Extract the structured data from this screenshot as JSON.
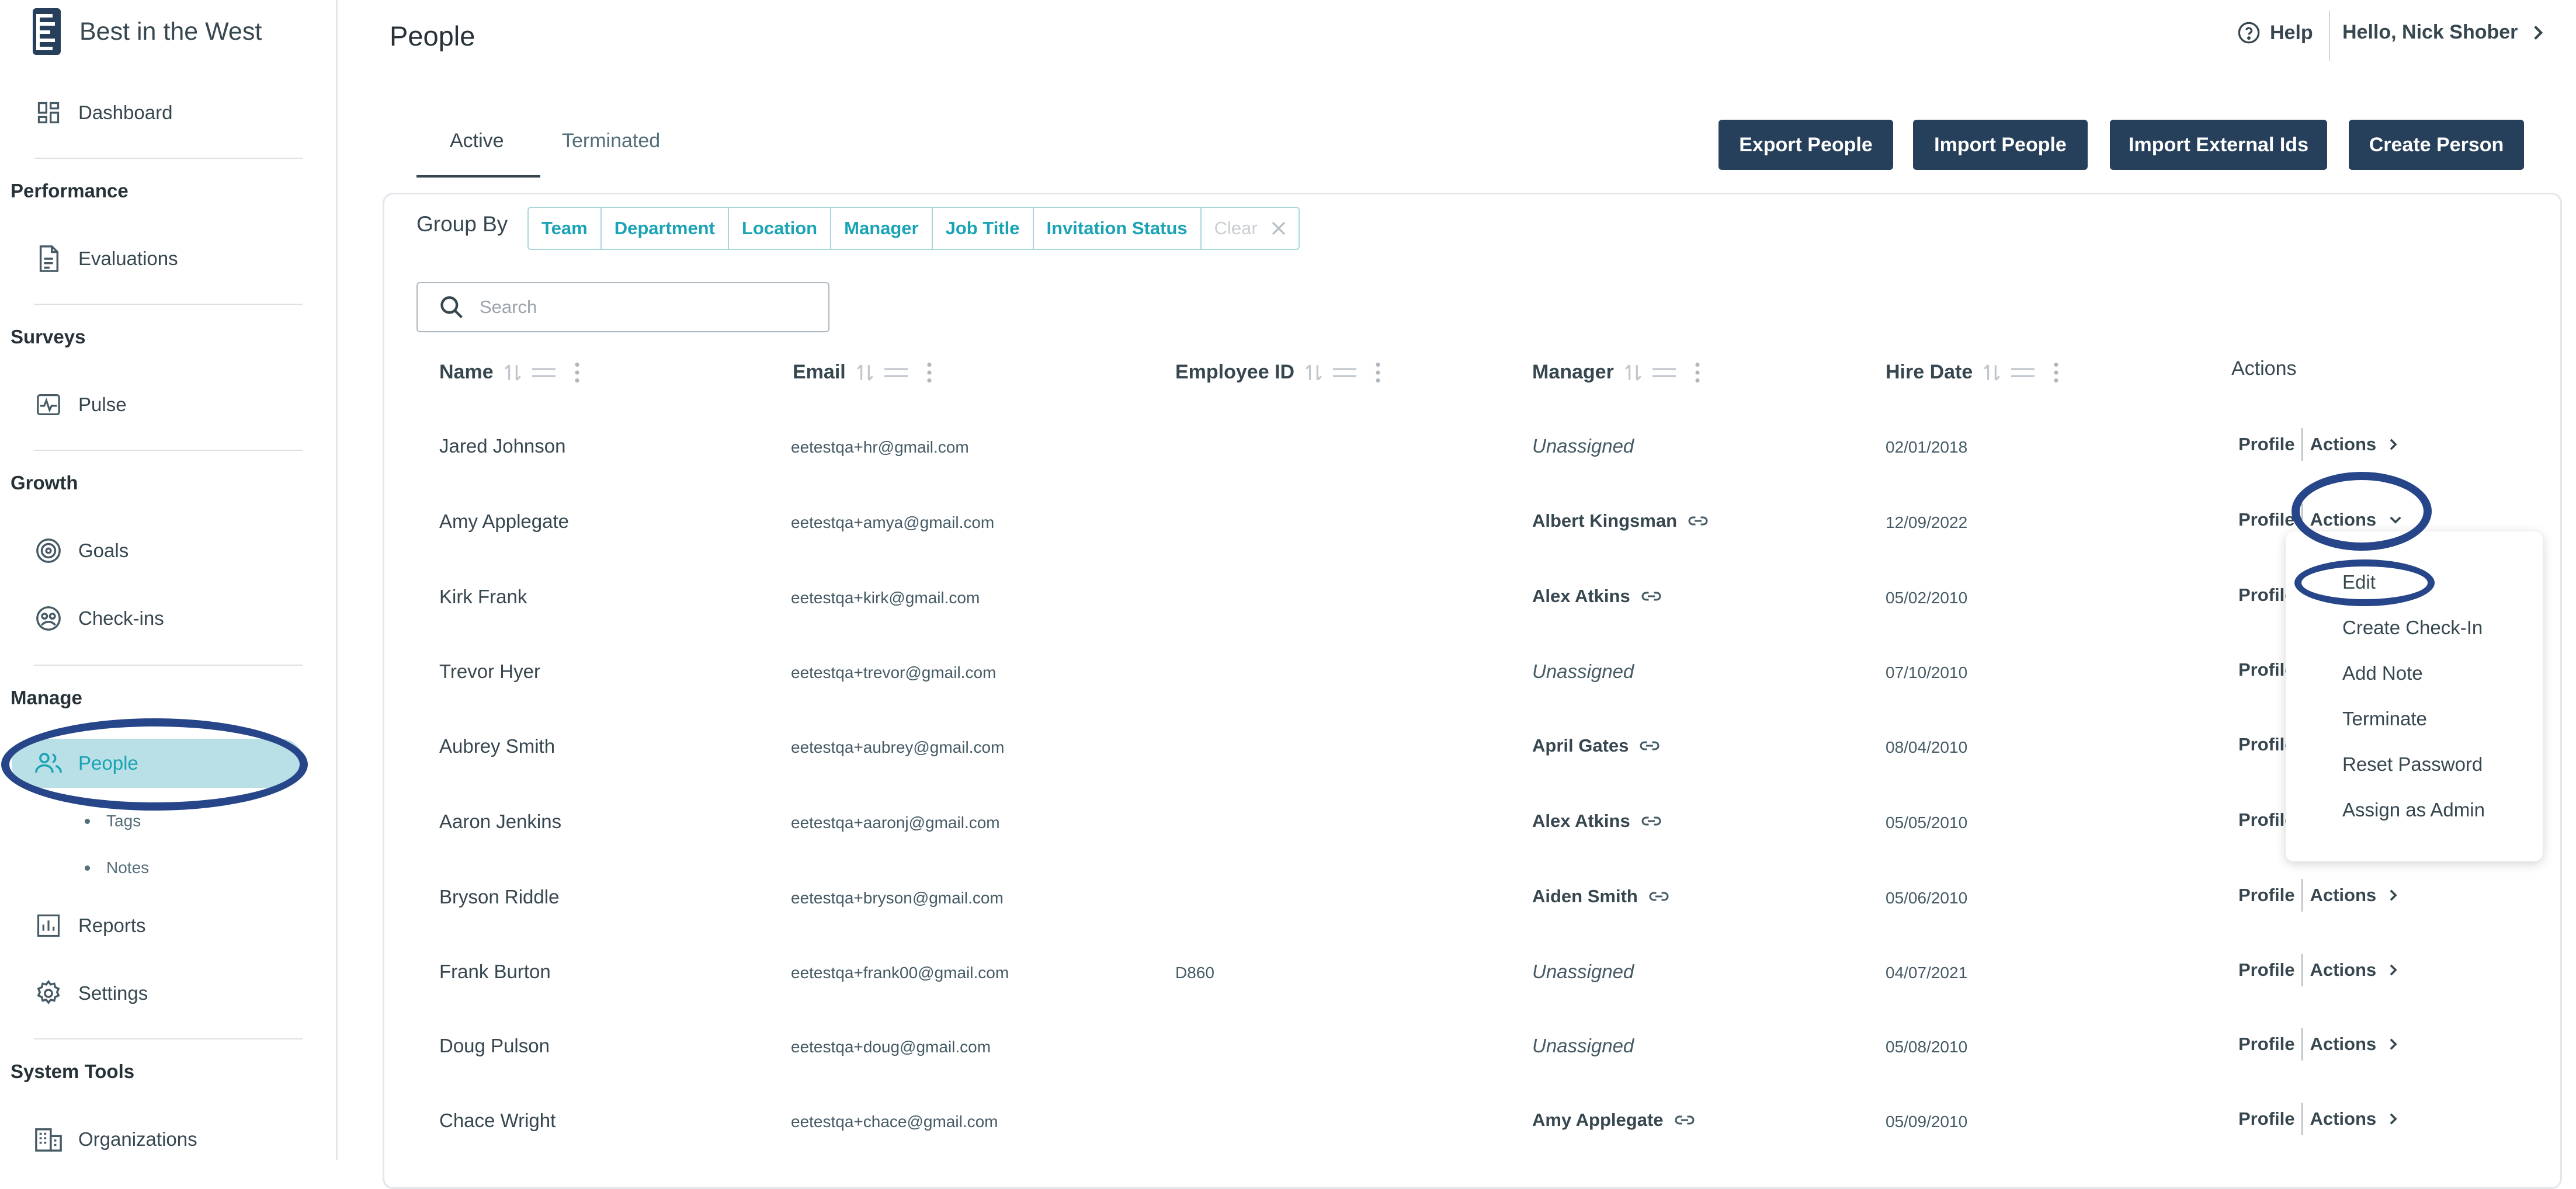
{
  "app": {
    "title": "Best in the West"
  },
  "sidebar": {
    "dashboard": "Dashboard",
    "sections": {
      "performance": "Performance",
      "surveys": "Surveys",
      "growth": "Growth",
      "manage": "Manage",
      "system_tools": "System Tools"
    },
    "items": {
      "evaluations": "Evaluations",
      "pulse": "Pulse",
      "goals": "Goals",
      "checkins": "Check-ins",
      "people": "People",
      "reports": "Reports",
      "settings": "Settings",
      "organizations": "Organizations"
    },
    "subitems": {
      "tags": "Tags",
      "notes": "Notes"
    },
    "active_item": "People",
    "accent_color": "#1aa3b5"
  },
  "header": {
    "page_title": "People",
    "help": "Help",
    "user_greeting": "Hello, Nick Shober"
  },
  "tabs": {
    "active": "Active",
    "terminated": "Terminated"
  },
  "buttons": {
    "export": "Export People",
    "import": "Import People",
    "import_external": "Import External Ids",
    "create": "Create Person",
    "color": "#263f5b"
  },
  "group_by": {
    "label": "Group By",
    "options": [
      "Team",
      "Department",
      "Location",
      "Manager",
      "Job Title",
      "Invitation Status"
    ],
    "clear": "Clear"
  },
  "search": {
    "placeholder": "Search",
    "value": ""
  },
  "table": {
    "columns": {
      "name": "Name",
      "email": "Email",
      "employee_id": "Employee ID",
      "manager": "Manager",
      "hire_date": "Hire Date",
      "actions": "Actions"
    },
    "row_labels": {
      "profile": "Profile",
      "actions": "Actions"
    },
    "rows": [
      {
        "name": "Jared Johnson",
        "email": "eetestqa+hr@gmail.com",
        "employee_id": "",
        "manager": "Unassigned",
        "hire_date": "02/01/2018"
      },
      {
        "name": "Amy Applegate",
        "email": "eetestqa+amya@gmail.com",
        "employee_id": "",
        "manager": "Albert Kingsman",
        "hire_date": "12/09/2022"
      },
      {
        "name": "Kirk Frank",
        "email": "eetestqa+kirk@gmail.com",
        "employee_id": "",
        "manager": "Alex Atkins",
        "hire_date": "05/02/2010"
      },
      {
        "name": "Trevor Hyer",
        "email": "eetestqa+trevor@gmail.com",
        "employee_id": "",
        "manager": "Unassigned",
        "hire_date": "07/10/2010"
      },
      {
        "name": "Aubrey Smith",
        "email": "eetestqa+aubrey@gmail.com",
        "employee_id": "",
        "manager": "April Gates",
        "hire_date": "08/04/2010"
      },
      {
        "name": "Aaron Jenkins",
        "email": "eetestqa+aaronj@gmail.com",
        "employee_id": "",
        "manager": "Alex Atkins",
        "hire_date": "05/05/2010"
      },
      {
        "name": "Bryson Riddle",
        "email": "eetestqa+bryson@gmail.com",
        "employee_id": "",
        "manager": "Aiden Smith",
        "hire_date": "05/06/2010"
      },
      {
        "name": "Frank Burton",
        "email": "eetestqa+frank00@gmail.com",
        "employee_id": "D860",
        "manager": "Unassigned",
        "hire_date": "04/07/2021"
      },
      {
        "name": "Doug Pulson",
        "email": "eetestqa+doug@gmail.com",
        "employee_id": "",
        "manager": "Unassigned",
        "hire_date": "05/08/2010"
      },
      {
        "name": "Chace Wright",
        "email": "eetestqa+chace@gmail.com",
        "employee_id": "",
        "manager": "Amy Applegate",
        "hire_date": "05/09/2010"
      }
    ]
  },
  "actions_menu": {
    "open_row": "Amy Applegate",
    "items": [
      "Edit",
      "Create Check-In",
      "Add Note",
      "Terminate",
      "Reset Password",
      "Assign as Admin"
    ]
  },
  "annotation_color": "#27468a"
}
